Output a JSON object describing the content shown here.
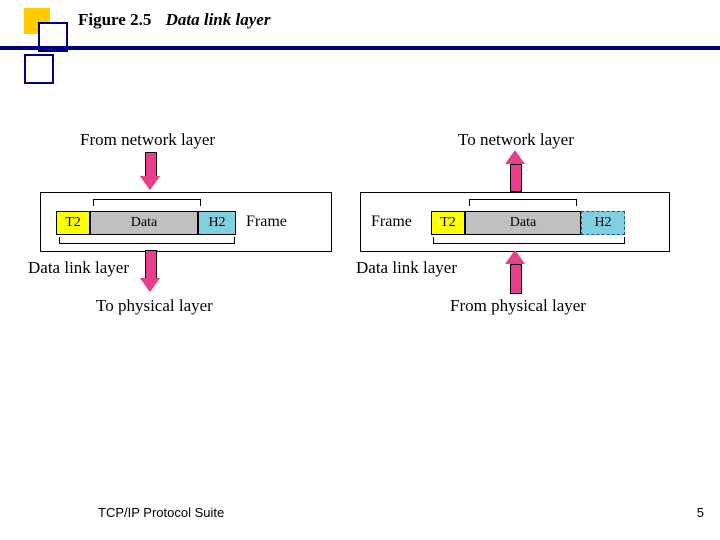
{
  "header": {
    "figure": "Figure 2.5",
    "title": "Data link layer"
  },
  "diagram": {
    "left": {
      "top_label": "From network layer",
      "frame_word": "Frame",
      "layer_label": "Data link layer",
      "bottom_label": "To physical layer",
      "segments": {
        "t": "T2",
        "d": "Data",
        "h": "H2"
      }
    },
    "right": {
      "top_label": "To network layer",
      "frame_word": "Frame",
      "layer_label": "Data link layer",
      "bottom_label": "From physical layer",
      "segments": {
        "t": "T2",
        "d": "Data",
        "h": "H2"
      }
    }
  },
  "footer": {
    "text": "TCP/IP Protocol Suite",
    "page": "5"
  }
}
